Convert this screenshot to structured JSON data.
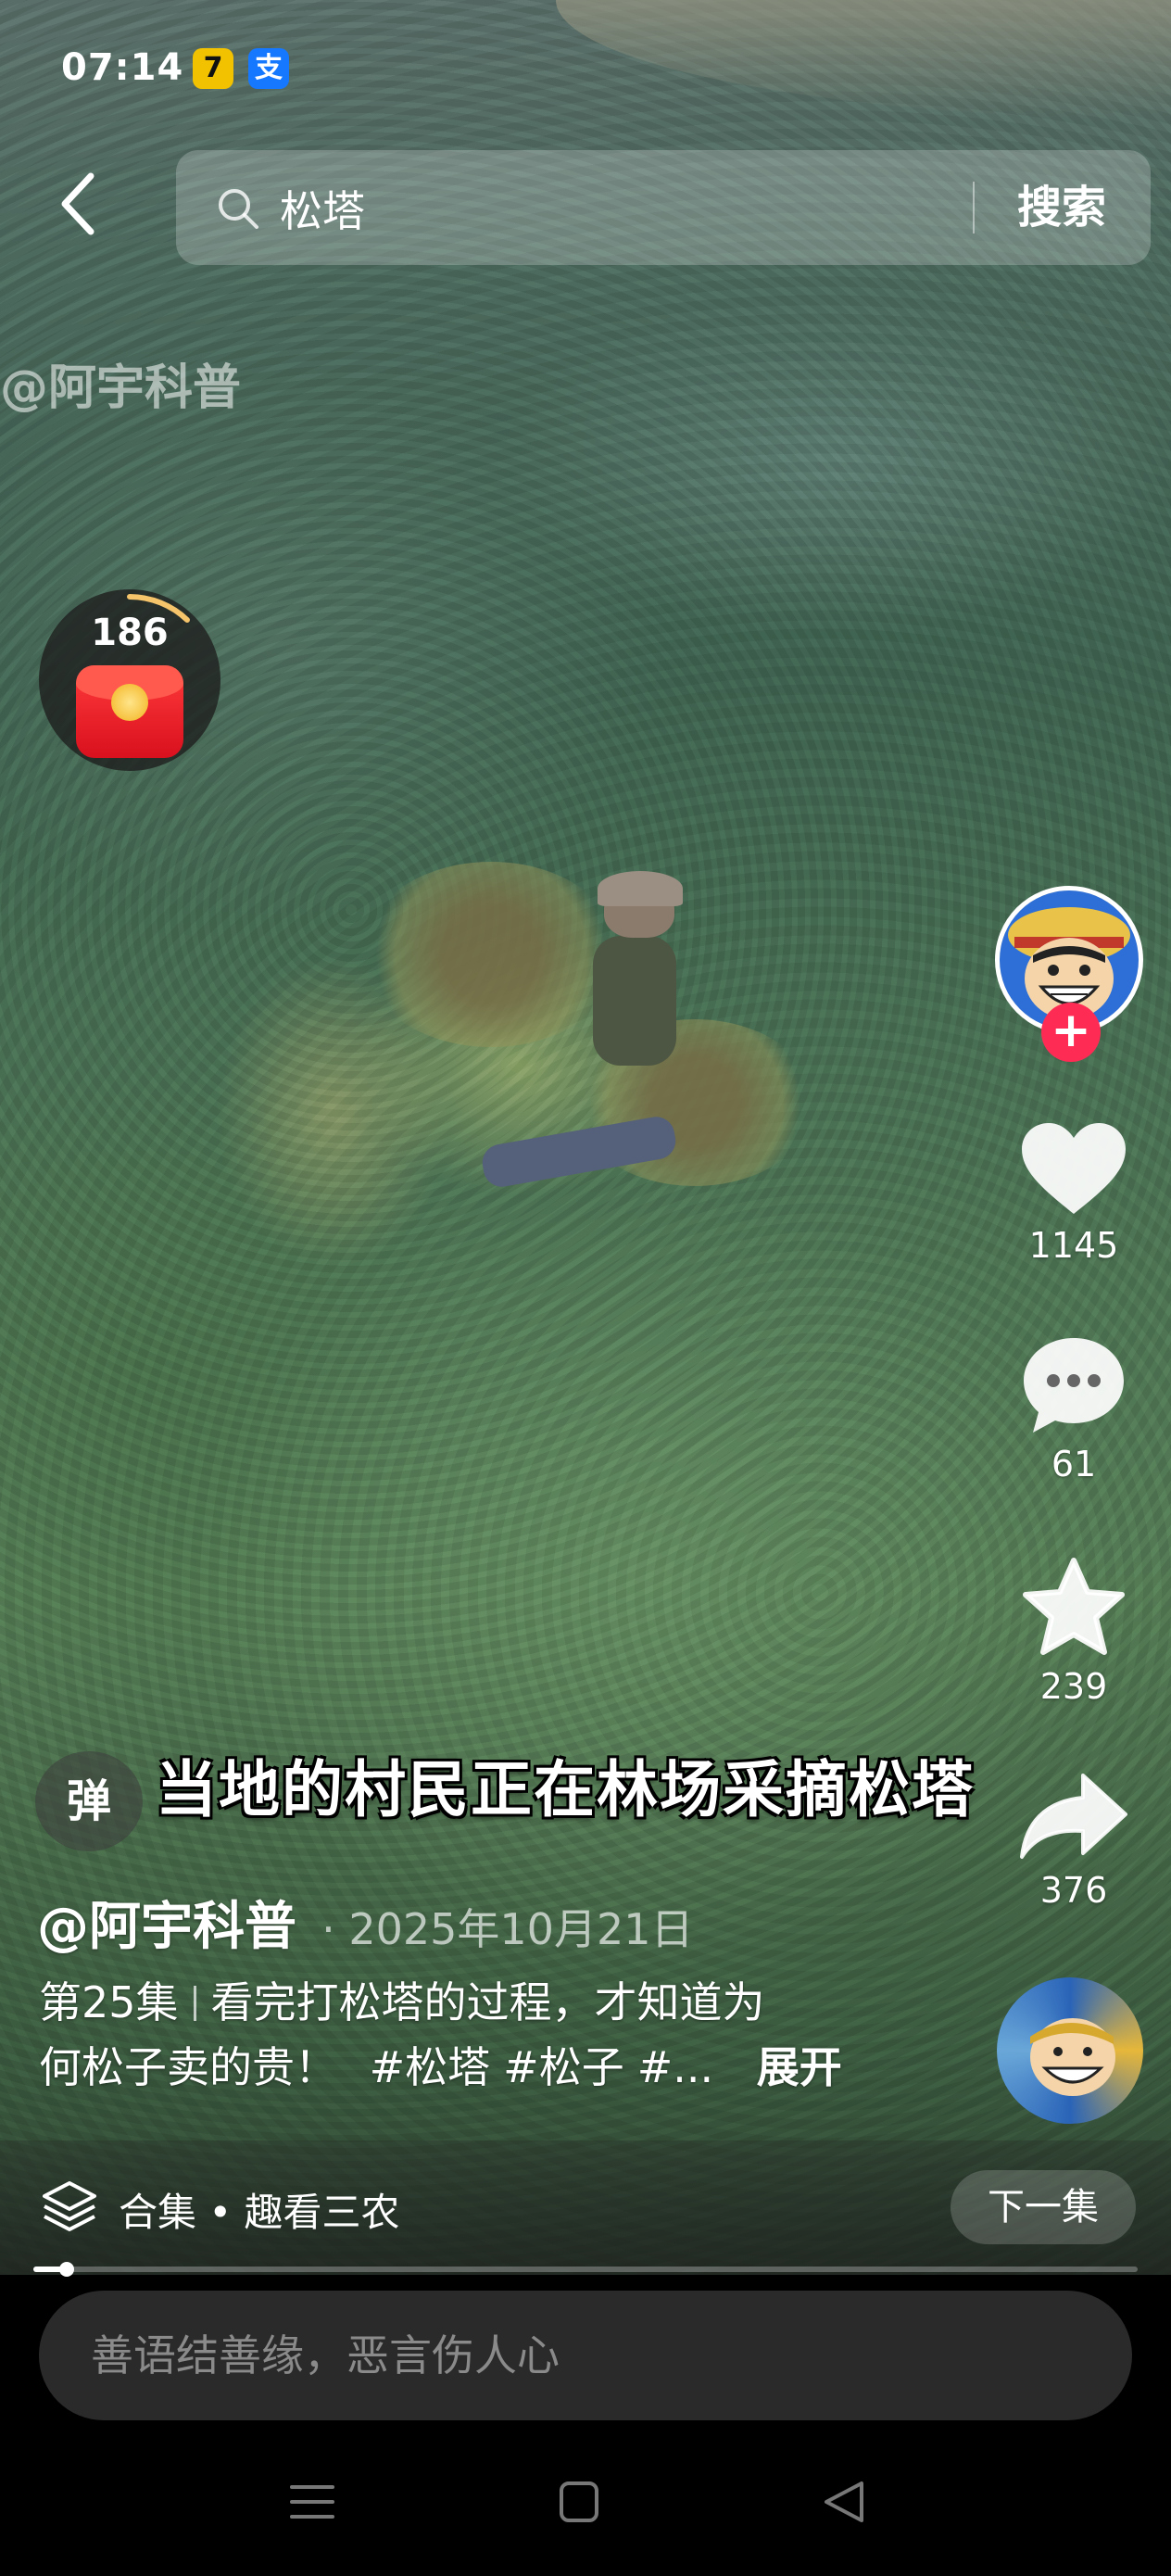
{
  "status_bar": {
    "time": "07:14",
    "apps": [
      "7",
      "支"
    ]
  },
  "search": {
    "query": "松塔",
    "button_label": "搜索"
  },
  "video": {
    "watermark": "@阿宇科普",
    "subtitle": "当地的村民正在林场采摘松塔"
  },
  "red_packet": {
    "count": "186"
  },
  "actions": {
    "likes": "1145",
    "comments": "61",
    "favorites": "239",
    "shares": "376"
  },
  "danmaku": {
    "label": "弹"
  },
  "post": {
    "author": "@阿宇科普",
    "date": "· 2025年10月21日",
    "episode": "第25集",
    "caption_line1": "看完打松塔的过程，才知道为",
    "caption_line2": "何松子卖的贵！",
    "hashtags": [
      "#松塔",
      "#松子",
      "#..."
    ],
    "expand_label": "展开"
  },
  "collection": {
    "label": "合集 • 趣看三农",
    "next_label": "下一集",
    "progress": 0.03
  },
  "comment": {
    "placeholder": "善语结善缘，恶言伤人心"
  },
  "colors": {
    "follow": "#fe2c55",
    "red_packet": "#e8141f",
    "background": "#000000"
  }
}
